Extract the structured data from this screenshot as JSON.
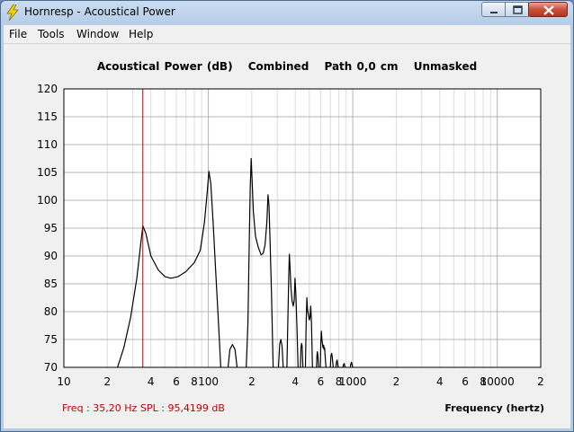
{
  "window": {
    "title": "Hornresp - Acoustical Power",
    "icon": "lightning-icon",
    "controls": [
      "minimize-icon",
      "maximize-icon",
      "close-icon"
    ]
  },
  "menu": {
    "items": [
      {
        "label": "File"
      },
      {
        "label": "Tools"
      },
      {
        "label": "Window"
      },
      {
        "label": "Help"
      }
    ]
  },
  "header": {
    "quantity": "Acoustical Power (dB)",
    "mode": "Combined",
    "path": "Path 0,0 cm",
    "mask": "Unmasked"
  },
  "readout": {
    "freq": "Freq : 35,20 Hz",
    "spl": "SPL : 95,4199 dB"
  },
  "colors": {
    "cursor": "#c00000",
    "curve": "#000000",
    "grid_major": "#b4b4b4",
    "grid_minor": "#dcdcdc",
    "readout_text": "#c00000"
  },
  "chart_data": {
    "type": "line",
    "xlabel": "Frequency (hertz)",
    "x_scale": "log",
    "xlim": [
      10,
      20000
    ],
    "ylim": [
      70,
      120
    ],
    "y_ticks": [
      70,
      75,
      80,
      85,
      90,
      95,
      100,
      105,
      110,
      115,
      120
    ],
    "x_tick_labels": [
      {
        "v": 10,
        "t": "10"
      },
      {
        "v": 20,
        "t": "2"
      },
      {
        "v": 40,
        "t": "4"
      },
      {
        "v": 60,
        "t": "6"
      },
      {
        "v": 80,
        "t": "8"
      },
      {
        "v": 100,
        "t": "100"
      },
      {
        "v": 200,
        "t": "2"
      },
      {
        "v": 400,
        "t": "4"
      },
      {
        "v": 600,
        "t": "6"
      },
      {
        "v": 800,
        "t": "8"
      },
      {
        "v": 1000,
        "t": "1000"
      },
      {
        "v": 2000,
        "t": "2"
      },
      {
        "v": 4000,
        "t": "4"
      },
      {
        "v": 6000,
        "t": "6"
      },
      {
        "v": 8000,
        "t": "8"
      },
      {
        "v": 10000,
        "t": "10000"
      },
      {
        "v": 20000,
        "t": "2"
      }
    ],
    "cursor_x": 35.2,
    "grid": true,
    "series": [
      {
        "segments": [
          [
            [
              23.5,
              70
            ],
            [
              26,
              73.5
            ],
            [
              29,
              79
            ],
            [
              32,
              86
            ],
            [
              34,
              92
            ],
            [
              35.2,
              95.4
            ],
            [
              37,
              94
            ],
            [
              40,
              90
            ],
            [
              45,
              87.5
            ],
            [
              50,
              86.3
            ],
            [
              55,
              86
            ],
            [
              62,
              86.3
            ],
            [
              70,
              87.2
            ],
            [
              80,
              88.8
            ],
            [
              88,
              91
            ],
            [
              94,
              96
            ],
            [
              98,
              101
            ],
            [
              101,
              105.2
            ],
            [
              104,
              103
            ],
            [
              108,
              96
            ],
            [
              112,
              88
            ],
            [
              117,
              79
            ],
            [
              122,
              70
            ]
          ],
          [
            [
              137,
              70
            ],
            [
              141,
              73.2
            ],
            [
              147,
              74.1
            ],
            [
              153,
              73.2
            ],
            [
              158,
              70
            ]
          ],
          [
            [
              183,
              70
            ],
            [
              188,
              78
            ],
            [
              192,
              92
            ],
            [
              195,
              102
            ],
            [
              198,
              107.5
            ],
            [
              200.5,
              104
            ],
            [
              205,
              98
            ],
            [
              212,
              93.5
            ],
            [
              222,
              91.5
            ],
            [
              232,
              90.2
            ],
            [
              240,
              90.5
            ],
            [
              247,
              92
            ],
            [
              254,
              96
            ],
            [
              259,
              101
            ],
            [
              263,
              99
            ],
            [
              268,
              92
            ],
            [
              274,
              83
            ],
            [
              281,
              70
            ]
          ],
          [
            [
              306,
              70
            ],
            [
              312,
              74.2
            ],
            [
              318,
              75
            ],
            [
              324,
              73.8
            ],
            [
              330,
              70
            ]
          ],
          [
            [
              350,
              70
            ],
            [
              355,
              78
            ],
            [
              360,
              86
            ],
            [
              364,
              90.3
            ],
            [
              368,
              88
            ],
            [
              373,
              84.5
            ],
            [
              380,
              82
            ],
            [
              387,
              81
            ],
            [
              393,
              82
            ],
            [
              398,
              86
            ],
            [
              404,
              83
            ],
            [
              411,
              77
            ],
            [
              418,
              70
            ]
          ],
          [
            [
              434,
              70
            ],
            [
              438,
              73.5
            ],
            [
              442,
              74.3
            ],
            [
              446,
              73.8
            ],
            [
              452,
              70
            ]
          ],
          [
            [
              470,
              70
            ],
            [
              476,
              78
            ],
            [
              481,
              82.5
            ],
            [
              485,
              80.5
            ],
            [
              492,
              79.5
            ],
            [
              500,
              78.5
            ],
            [
              506,
              79
            ],
            [
              512,
              81
            ],
            [
              518,
              78
            ],
            [
              526,
              70
            ]
          ],
          [
            [
              561,
              70
            ],
            [
              565,
              72.2
            ],
            [
              569,
              72.8
            ],
            [
              574,
              72
            ],
            [
              580,
              70
            ]
          ],
          [
            [
              596,
              70
            ],
            [
              601,
              74.5
            ],
            [
              606,
              76.5
            ],
            [
              611,
              75
            ],
            [
              618,
              74
            ],
            [
              623,
              73.5
            ],
            [
              628,
              74
            ],
            [
              633,
              73.2
            ],
            [
              638,
              73.5
            ],
            [
              644,
              72
            ],
            [
              652,
              70
            ]
          ],
          [
            [
              700,
              70
            ],
            [
              706,
              72
            ],
            [
              714,
              72.5
            ],
            [
              720,
              72
            ],
            [
              726,
              71
            ],
            [
              732,
              70
            ]
          ],
          [
            [
              765,
              70
            ],
            [
              771,
              71
            ],
            [
              780,
              71.3
            ],
            [
              786,
              70.6
            ],
            [
              792,
              70
            ]
          ],
          [
            [
              855,
              70
            ],
            [
              862,
              70.5
            ],
            [
              872,
              70.7
            ],
            [
              880,
              70.2
            ],
            [
              888,
              70
            ]
          ],
          [
            [
              960,
              70
            ],
            [
              968,
              70.5
            ],
            [
              978,
              70.9
            ],
            [
              988,
              70.5
            ],
            [
              998,
              70
            ]
          ]
        ]
      }
    ]
  }
}
